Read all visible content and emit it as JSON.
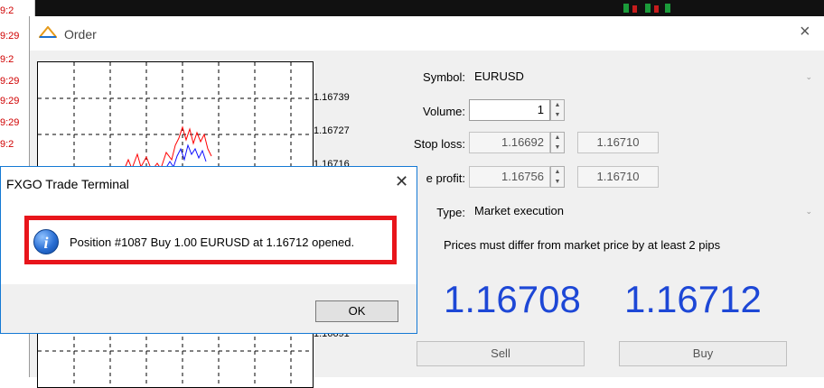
{
  "background": {
    "times": [
      "9:2",
      "9:29",
      "9:2",
      "9:29",
      "9:29",
      "9:29",
      "9:2"
    ]
  },
  "order_dialog": {
    "title": "Order",
    "close_glyph": "×",
    "chart": {
      "price_labels": [
        "1.16739",
        "1.16727",
        "1.16716",
        "1.16691"
      ]
    },
    "symbol_label": "Symbol:",
    "symbol_value": "EURUSD",
    "volume_label": "Volume:",
    "volume_value": "1",
    "stop_loss_label": "Stop loss:",
    "stop_loss_value": "1.16692",
    "stop_loss_price": "1.16710",
    "take_profit_label": "e profit:",
    "take_profit_value": "1.16756",
    "take_profit_price": "1.16710",
    "type_label": "Type:",
    "type_value": "Market execution",
    "hint": "Prices must differ from market price by at least 2 pips",
    "bid": "1.16708",
    "ask": "1.16712",
    "sell_label": "Sell",
    "buy_label": "Buy"
  },
  "message_box": {
    "title": "FXGO Trade Terminal",
    "close_glyph": "✕",
    "message": "Position #1087 Buy 1.00 EURUSD at 1.16712 opened.",
    "ok_label": "OK"
  },
  "colors": {
    "price_blue": "#1d47d6",
    "highlight_red": "#e8151b",
    "chart_ask_line": "#ff0000",
    "chart_bid_line": "#1010ff"
  }
}
